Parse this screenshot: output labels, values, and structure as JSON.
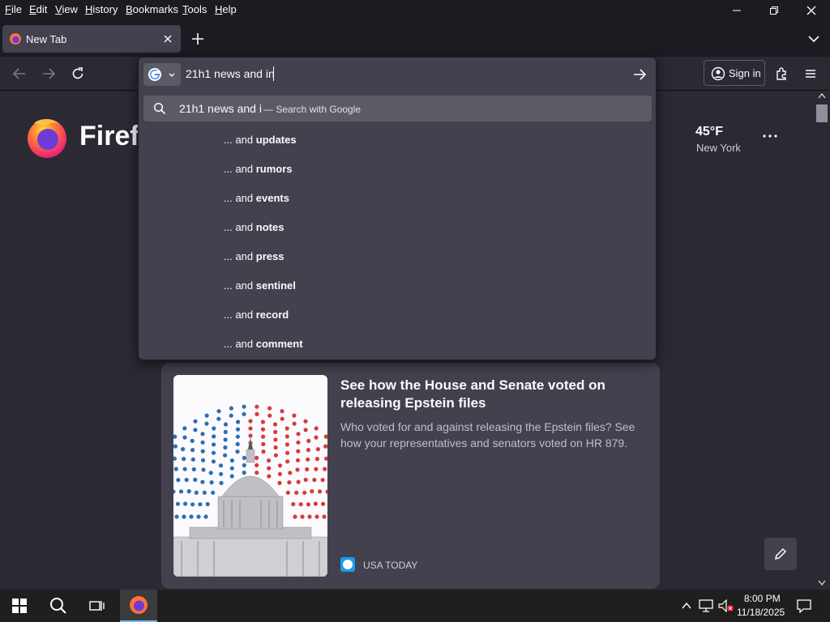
{
  "menubar": {
    "items": [
      "File",
      "Edit",
      "View",
      "History",
      "Bookmarks",
      "Tools",
      "Help"
    ],
    "mnemonics": [
      "F",
      "E",
      "V",
      "H",
      "B",
      "T",
      "H"
    ],
    "rest": [
      "ile",
      "dit",
      "iew",
      "istory",
      "ookmarks",
      "ools",
      "elp"
    ]
  },
  "window_controls": {
    "minimize": "minimize-icon",
    "restore": "restore-icon",
    "close": "close-icon"
  },
  "tabs": [
    {
      "label": "New Tab",
      "icon": "firefox-icon"
    }
  ],
  "toolbar": {
    "sign_in_label": "Sign in"
  },
  "urlbar": {
    "value": "21h1 news and in",
    "engine": "Google",
    "heuristic": {
      "query": "21h1 news and i",
      "action": "— Search with Google"
    },
    "suggestion_prefix": "... and ",
    "suggestions": [
      "updates",
      "rumors",
      "events",
      "notes",
      "press",
      "sentinel",
      "record",
      "comment"
    ]
  },
  "newtab": {
    "brand": "Firefox",
    "weather": {
      "temp": "45°F",
      "city": "New York"
    }
  },
  "story": {
    "title": "See how the House and Senate voted on releasing Epstein files",
    "excerpt": "Who voted for and against releasing the Epstein files? See how your representatives and senators voted on HR 879.",
    "source": "USA TODAY"
  },
  "taskbar": {
    "time": "8:00 PM",
    "date": "11/18/2025"
  },
  "colors": {
    "chrome_dark": "#1c1b22",
    "panel": "#42414d",
    "content_bg": "#2b2a33",
    "firefox_orange": "#ff7139",
    "firefox_purple": "#6f3ad6",
    "vote_blue": "#2f6db5",
    "vote_red": "#d93a3a"
  }
}
